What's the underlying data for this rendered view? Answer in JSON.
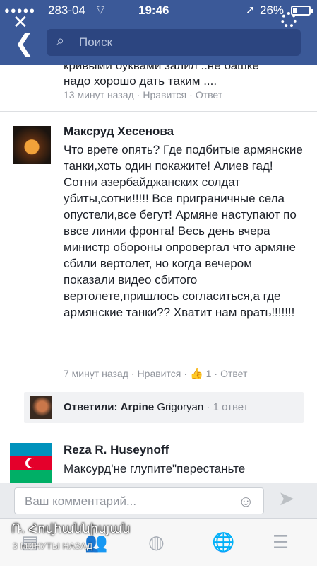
{
  "status_bar": {
    "signal": "●●●●●",
    "carrier": "283-04",
    "time": "19:46",
    "battery": "26%",
    "battery_level": 0.26
  },
  "header": {
    "search_placeholder": "Поиск"
  },
  "comments": [
    {
      "text": "надо хорошо дать таким ....",
      "partial_top": "кривыми буквами залил ..не башке",
      "time": "13 минут назад",
      "like": "Нравится",
      "reply": "Ответ"
    },
    {
      "author": "Максруд Хесенова",
      "text": "Что врете опять? Где подбитые армянские танки,хоть один покажите! Алиев гад! Сотни азербайджанских солдат убиты,сотни!!!!! Все приграничные села опустели,все бегут! Армяне наступают по ввсе линии фронта! Весь день вчера министр обороны опровергал что армяне сбили вертолет, но когда вечером показали видео сбитого вертолете,пришлось согласиться,а где армянские танки?? Хватит нам врать!!!!!!!",
      "time": "7 минут назад",
      "like": "Нравится",
      "like_count": "1",
      "reply": "Ответ"
    },
    {
      "author": "Reza R. Huseynoff",
      "text": "Максурд'не глупите\"перестаньте"
    }
  ],
  "replies": {
    "label": "Ответили:",
    "name": "Arpine",
    "surname": "Grigoryan",
    "count": "1 ответ"
  },
  "composer": {
    "placeholder": "Ваш комментарий..."
  },
  "overlay": {
    "name": "Ռ. Հովհաննիսյան",
    "time": "3 МИНУТЫ НАЗАД"
  },
  "icons": [
    "close-icon",
    "settings-icon",
    "back-icon",
    "search-icon",
    "like-icon",
    "emoji-icon",
    "send-icon",
    "news-feed-icon",
    "friends-icon",
    "messenger-icon",
    "globe-icon",
    "menu-icon"
  ]
}
